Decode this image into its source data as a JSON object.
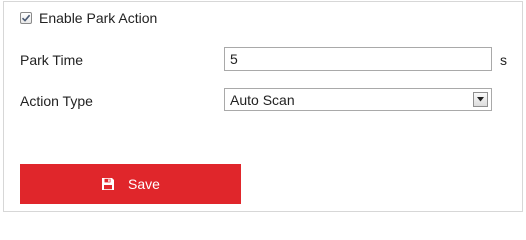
{
  "enable": {
    "label": "Enable Park Action",
    "checked": true
  },
  "park_time": {
    "label": "Park Time",
    "value": "5",
    "unit": "s"
  },
  "action_type": {
    "label": "Action Type",
    "selected": "Auto Scan"
  },
  "save": {
    "label": "Save"
  },
  "colors": {
    "accent": "#e0262b",
    "border": "#d7d7d7"
  },
  "icons": {
    "checkbox": "check-icon",
    "dropdown": "dropdown-arrow-icon",
    "save": "floppy-disk-icon"
  }
}
